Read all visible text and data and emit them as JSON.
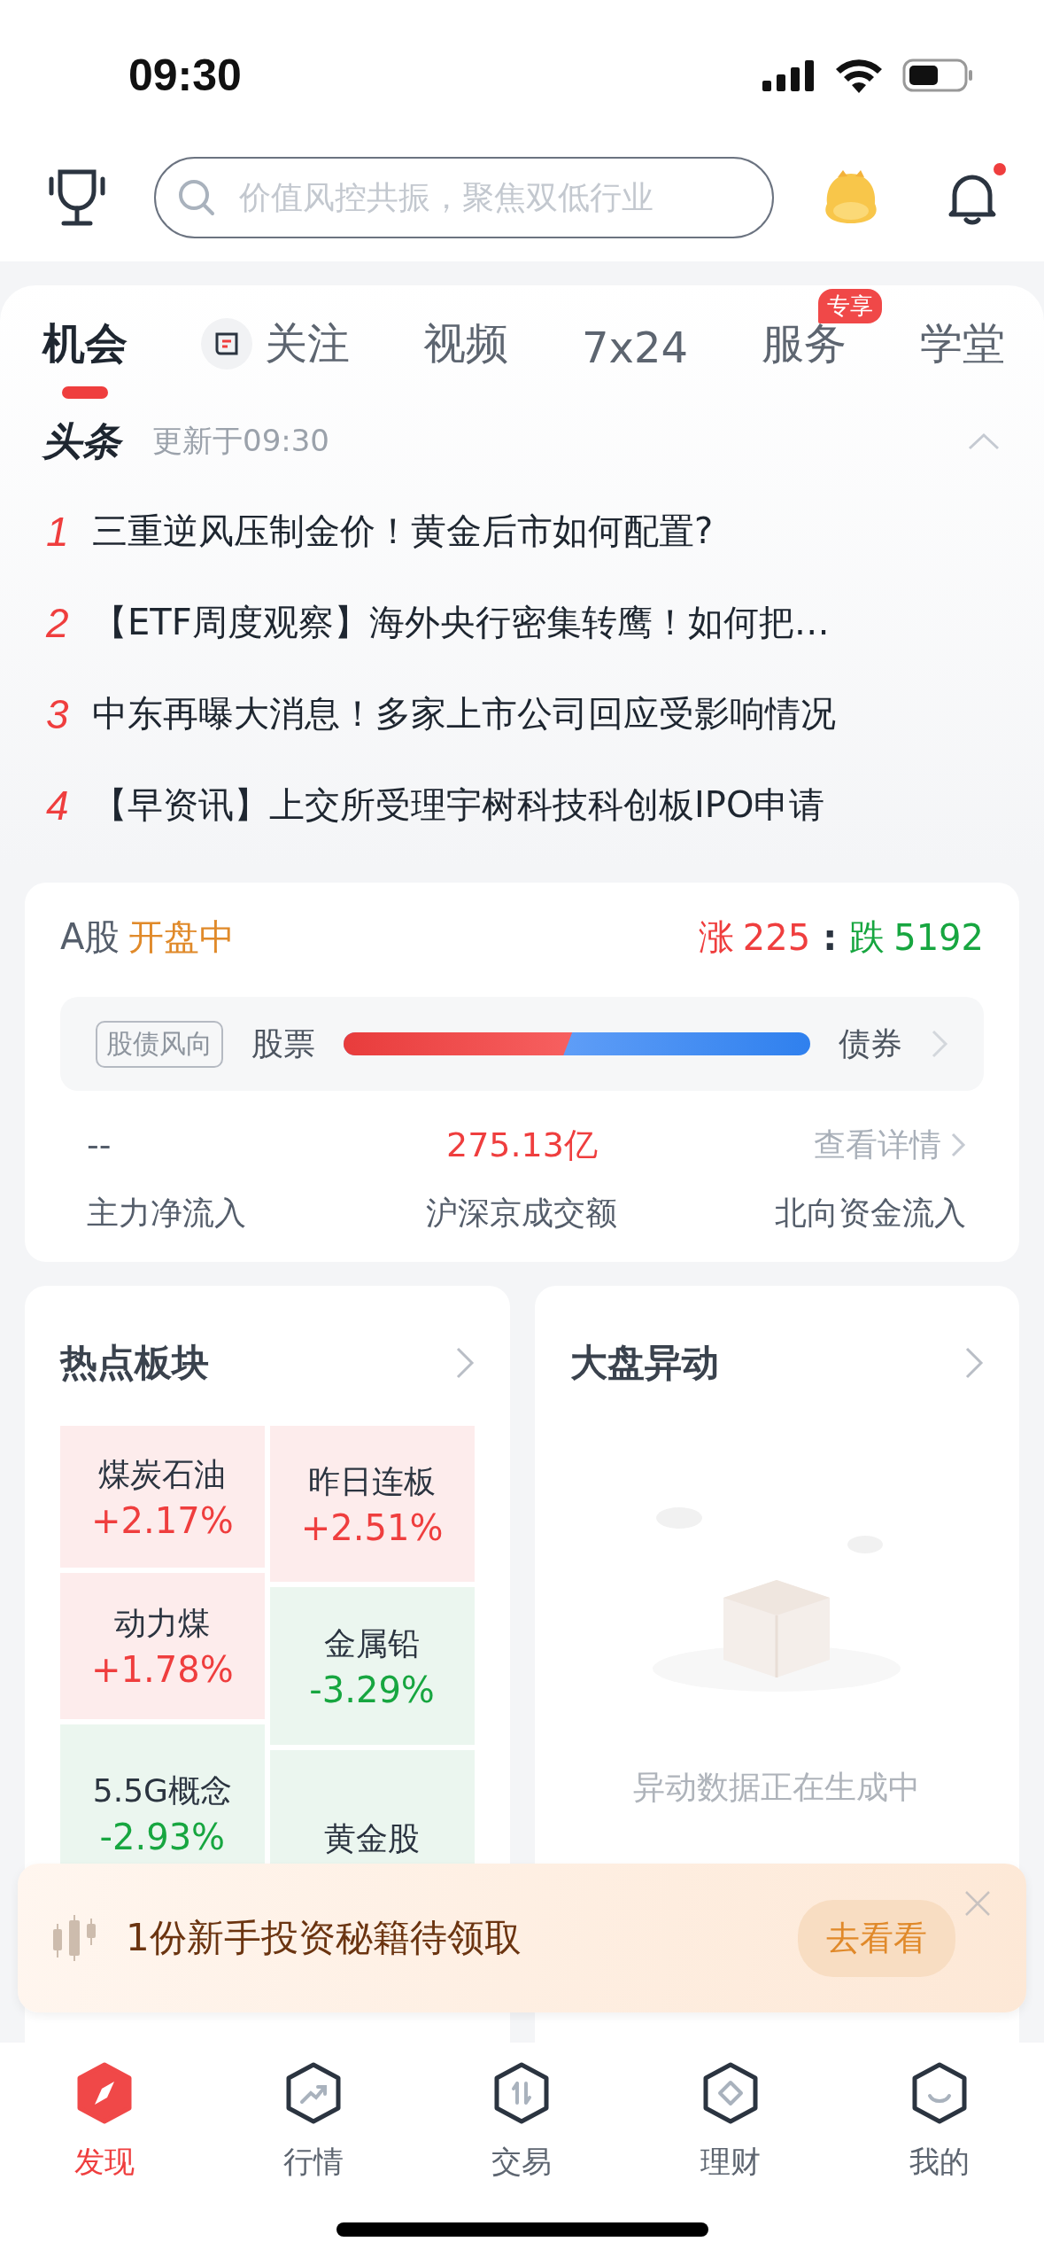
{
  "status_bar": {
    "time": "09:30"
  },
  "header": {
    "search": {
      "placeholder": "价值风控共振，聚焦双低行业"
    },
    "notification_dot": true
  },
  "tabs": [
    {
      "label": "机会",
      "selected": true,
      "kind": "text"
    },
    {
      "label": "关注",
      "selected": false,
      "kind": "icon_text"
    },
    {
      "label": "视频",
      "selected": false,
      "kind": "text"
    },
    {
      "label": "7x24",
      "selected": false,
      "kind": "text"
    },
    {
      "label": "服务",
      "selected": false,
      "kind": "text",
      "badge": "专享"
    },
    {
      "label": "学堂",
      "selected": false,
      "kind": "text"
    }
  ],
  "headlines": {
    "logo": "头条",
    "updated": "更新于09:30",
    "expanded": true,
    "items": [
      {
        "rank": "1",
        "title": "三重逆风压制金价！黄金后市如何配置?"
      },
      {
        "rank": "2",
        "title": "【ETF周度观察】海外央行密集转鹰！如何把…"
      },
      {
        "rank": "3",
        "title": "中东再曝大消息！多家上市公司回应受影响情况"
      },
      {
        "rank": "4",
        "title": "【早资讯】上交所受理宇树科技科创板IPO申请"
      }
    ]
  },
  "market": {
    "name": "A股",
    "status": "开盘中",
    "up_label": "涨",
    "up_count": "225",
    "separator": ":",
    "down_label": "跌",
    "down_count": "5192",
    "sentiment": {
      "tag": "股债风向",
      "left": "股票",
      "right": "债券",
      "level": 0.49
    },
    "stats": [
      {
        "value": "--",
        "label": "主力净流入",
        "kind": "plain"
      },
      {
        "value": "275.13亿",
        "label": "沪深京成交额",
        "kind": "highlight"
      },
      {
        "value": "查看详情",
        "label": "北向资金流入",
        "kind": "link"
      }
    ]
  },
  "hot_sectors": {
    "title": "热点板块",
    "columns": [
      [
        {
          "name": "煤炭石油",
          "change": "+2.17%",
          "kind": "up"
        },
        {
          "name": "动力煤",
          "change": "+1.78%",
          "kind": "up"
        },
        {
          "name": "5.5G概念",
          "change": "-2.93%",
          "kind": "down"
        }
      ],
      [
        {
          "name": "昨日连板",
          "change": "+2.51%",
          "kind": "up"
        },
        {
          "name": "金属铅",
          "change": "-3.29%",
          "kind": "down"
        },
        {
          "name": "黄金股",
          "kind": "down"
        }
      ]
    ]
  },
  "market_moves": {
    "title": "大盘异动",
    "empty_text": "异动数据正在生成中"
  },
  "promo": {
    "text": "1份新手投资秘籍待领取",
    "button": "去看看"
  },
  "bottom_nav": [
    {
      "label": "发现",
      "selected": true,
      "kind": "compass"
    },
    {
      "label": "行情",
      "selected": false,
      "kind": "trend"
    },
    {
      "label": "交易",
      "selected": false,
      "kind": "trade"
    },
    {
      "label": "理财",
      "selected": false,
      "kind": "diamond"
    },
    {
      "label": "我的",
      "selected": false,
      "kind": "smile"
    }
  ]
}
